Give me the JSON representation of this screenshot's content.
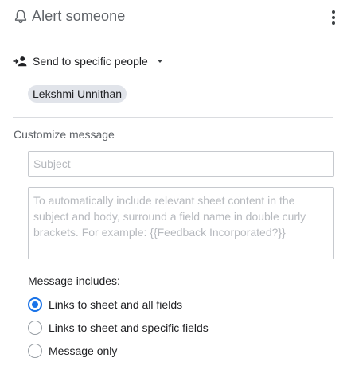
{
  "header": {
    "icon": "bell-icon",
    "title": "Alert someone",
    "menu_icon": "more-vert-icon"
  },
  "recipients": {
    "icon": "person-add-icon",
    "mode_label": "Send to specific people",
    "chips": [
      "Lekshmi Unnithan"
    ]
  },
  "customize": {
    "label": "Customize message",
    "subject_placeholder": "Subject",
    "body_placeholder": "To automatically include relevant sheet content in the subject and body, surround a field name in double curly brackets. For example: {{Feedback Incorporated?}}"
  },
  "includes": {
    "label": "Message includes:",
    "options": [
      {
        "label": "Links to sheet and all fields",
        "selected": true
      },
      {
        "label": "Links to sheet and specific fields",
        "selected": false
      },
      {
        "label": "Message only",
        "selected": false
      }
    ]
  },
  "colors": {
    "accent": "#1a73e8",
    "chip_bg": "#e1e4ea",
    "muted_text": "#5f6368"
  }
}
